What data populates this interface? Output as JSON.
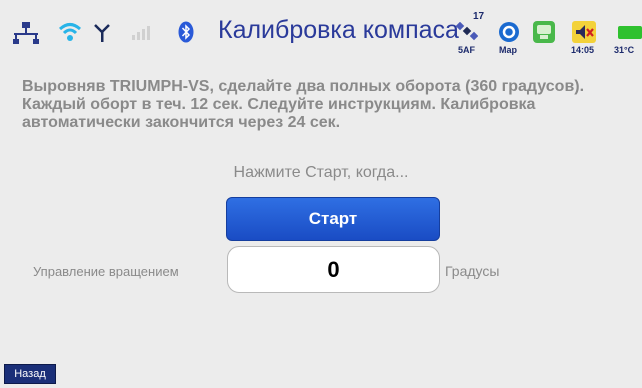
{
  "status_bar": {
    "title": "Калибровка компаса",
    "satellite_count": "17",
    "satellite_label": "5AF",
    "map_label": "Map",
    "time": "14:05",
    "temperature": "31°C"
  },
  "main": {
    "instructions": "Выровняв TRIUMPH-VS, сделайте два полных оборота (360 градусов). Каждый оборт в теч. 12 сек. Следуйте инструкциям. Калибровка автоматически закончится через 24 сек.",
    "prompt": "Нажмите Старт, когда...",
    "start_label": "Старт",
    "rotation_label": "Управление вращением",
    "rotation_value": "0",
    "units_label": "Градусы"
  },
  "footer": {
    "back_label": "Назад"
  },
  "colors": {
    "title": "#2a3a9a",
    "start_button": "#2058d0",
    "back_button": "#1a2f78",
    "background": "#ececec"
  }
}
